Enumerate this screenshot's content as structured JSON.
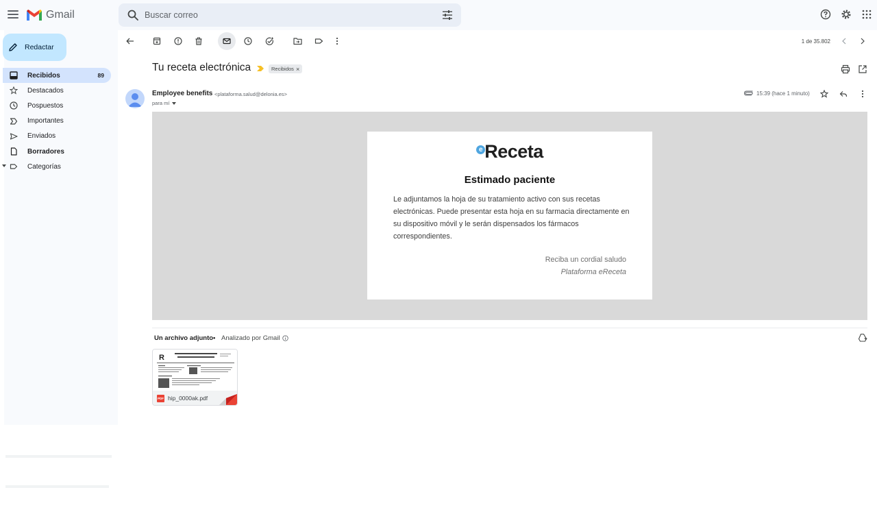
{
  "app": {
    "name": "Gmail"
  },
  "search": {
    "placeholder": "Buscar correo"
  },
  "compose": {
    "label": "Redactar"
  },
  "sidebar": {
    "items": [
      {
        "label": "Recibidos",
        "count": "89",
        "icon": "inbox-icon"
      },
      {
        "label": "Destacados",
        "icon": "star-icon"
      },
      {
        "label": "Pospuestos",
        "icon": "clock-icon"
      },
      {
        "label": "Importantes",
        "icon": "important-icon"
      },
      {
        "label": "Enviados",
        "icon": "send-icon"
      },
      {
        "label": "Borradores",
        "icon": "draft-icon"
      },
      {
        "label": "Categorías",
        "icon": "label-icon"
      }
    ]
  },
  "toolbar": {
    "pager": "1 de 35.802"
  },
  "message": {
    "subject": "Tu receta electrónica",
    "label": "Recibidos",
    "label_remove": "×",
    "sender_name": "Employee benefits",
    "sender_email": "<plataforma.salud@delonia.es>",
    "to": "para mí",
    "time": "15:39 (hace 1 minuto)"
  },
  "email_body": {
    "brand_mark": "e",
    "brand": "Receta",
    "title": "Estimado paciente",
    "paragraph": "Le adjuntamos la hoja de su tratamiento activo con sus recetas electrónicas. Puede presentar esta hoja en su farmacia directamente en su dispositivo móvil y le serán dispensados los fármacos correspondientes.",
    "closing": "Reciba un cordial saludo",
    "signature": "Plataforma eReceta"
  },
  "attachments": {
    "title": "Un archivo adjunto",
    "separator": "•",
    "scan_note": "Analizado por Gmail",
    "file_name": "hip_0000ak.pdf",
    "file_type": "PDF"
  },
  "colors": {
    "compose_bg": "#c2e7ff",
    "active_nav": "#d3e3fd",
    "sidebar_bg": "#f8fafd",
    "important_marker": "#f6c026",
    "pdf_red": "#ea4335",
    "brand_blue": "#4fa6e0"
  }
}
